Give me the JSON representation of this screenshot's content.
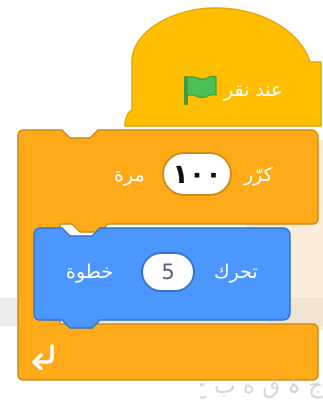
{
  "hat_block": {
    "label": "عند نقر",
    "flag_icon": "green-flag-icon"
  },
  "repeat_block": {
    "prefix": "كرّر",
    "count": "١٠٠",
    "suffix": "مرة",
    "loop_icon": "loop-arrow-icon"
  },
  "move_block": {
    "prefix": "تحرك",
    "steps": "5",
    "suffix": "خطوة"
  },
  "watermark": {
    "text": "ج ۃ ق ه ب ح ا ل ا"
  },
  "colors": {
    "events": "#ffbf00",
    "control": "#ffab19",
    "motion": "#4c97ff",
    "flag": "#4cbf56"
  }
}
